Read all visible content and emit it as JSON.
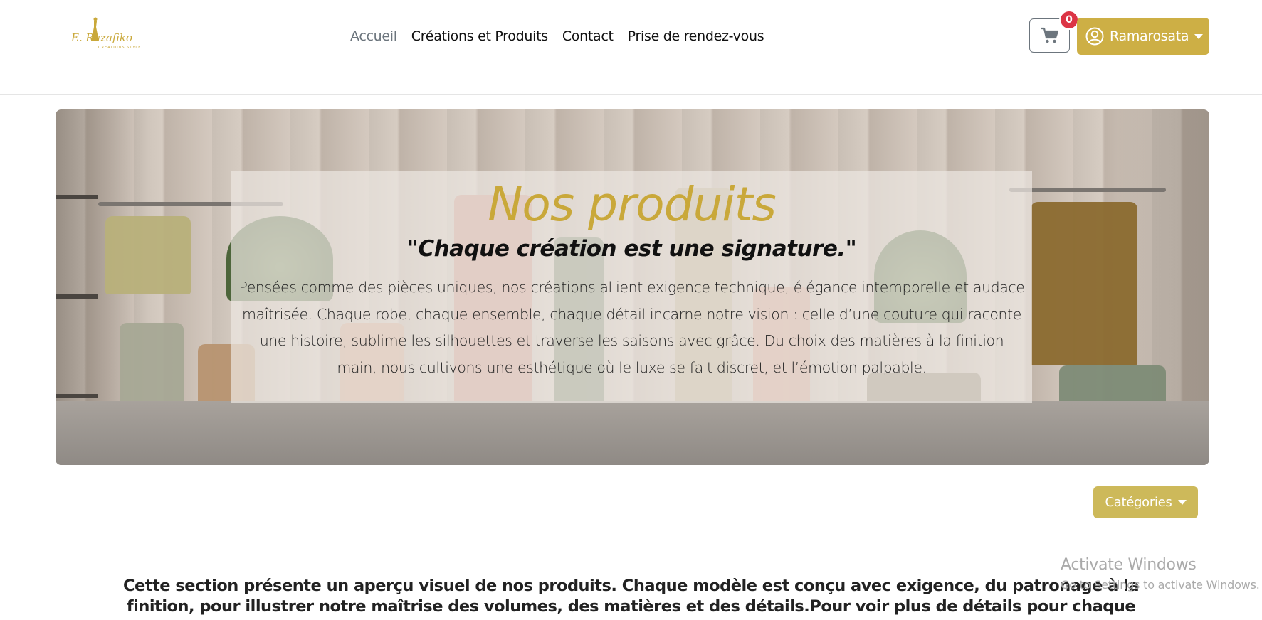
{
  "brand": {
    "logo_text": "E. Razafiko",
    "logo_sub": "CREATIONS STYLE"
  },
  "nav": {
    "links": [
      "Accueil",
      "Créations et Produits",
      "Contact",
      "Prise de rendez-vous"
    ],
    "active_index": 0
  },
  "cart": {
    "icon": "cart-icon",
    "count": "0"
  },
  "user": {
    "icon": "user-circle-icon",
    "name": "Ramarosata"
  },
  "hero": {
    "title": "Nos produits",
    "quote": "\"Chaque création est une signature.\"",
    "description": "Pensées comme des pièces uniques, nos créations allient exigence technique, élégance intemporelle et audace maîtrisée. Chaque robe, chaque ensemble, chaque détail incarne notre vision : celle d’une couture qui raconte une histoire, sublime les silhouettes et traverse les saisons avec grâce. Du choix des matières à la finition main, nous cultivons une esthétique où le luxe se fait discret, et l’émotion palpable."
  },
  "categories": {
    "label": "Catégories"
  },
  "intro": {
    "text": "Cette section présente un aperçu visuel de nos produits. Chaque modèle est conçu avec exigence, du patronage à la finition, pour illustrer notre maîtrise des volumes, des matières et des détails.Pour voir plus de détails pour chaque produit , veuillez"
  },
  "watermark": {
    "title": "Activate Windows",
    "subtitle": "Go to Settings to activate Windows."
  },
  "colors": {
    "accent": "#cdaf45",
    "badge": "#dc3545",
    "title_gold": "#c9a83a"
  }
}
